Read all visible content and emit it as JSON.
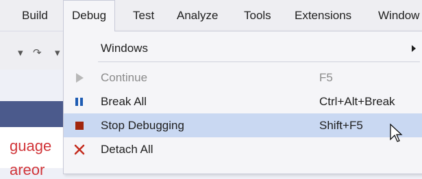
{
  "menubar": {
    "items": [
      "Build",
      "Debug",
      "Test",
      "Analyze",
      "Tools",
      "Extensions",
      "Window"
    ],
    "open_item": "Debug"
  },
  "editor": {
    "visible_text_1": "guage",
    "visible_text_2": "areor"
  },
  "dropdown": {
    "items": [
      {
        "label": "Windows",
        "shortcut": "",
        "has_submenu": true,
        "enabled": true,
        "icon": ""
      },
      {
        "label": "Continue",
        "shortcut": "F5",
        "has_submenu": false,
        "enabled": false,
        "icon": "play-icon"
      },
      {
        "label": "Break All",
        "shortcut": "Ctrl+Alt+Break",
        "has_submenu": false,
        "enabled": true,
        "icon": "pause-icon"
      },
      {
        "label": "Stop Debugging",
        "shortcut": "Shift+F5",
        "has_submenu": false,
        "enabled": true,
        "icon": "stop-icon",
        "highlighted": true
      },
      {
        "label": "Detach All",
        "shortcut": "",
        "has_submenu": false,
        "enabled": true,
        "icon": "close-icon"
      }
    ]
  },
  "colors": {
    "highlight": "#c9d8f2",
    "stop_icon": "#a1260d",
    "pause_icon": "#1e5cb3",
    "detach_icon": "#c42b1c",
    "editor_text": "#d13438"
  }
}
